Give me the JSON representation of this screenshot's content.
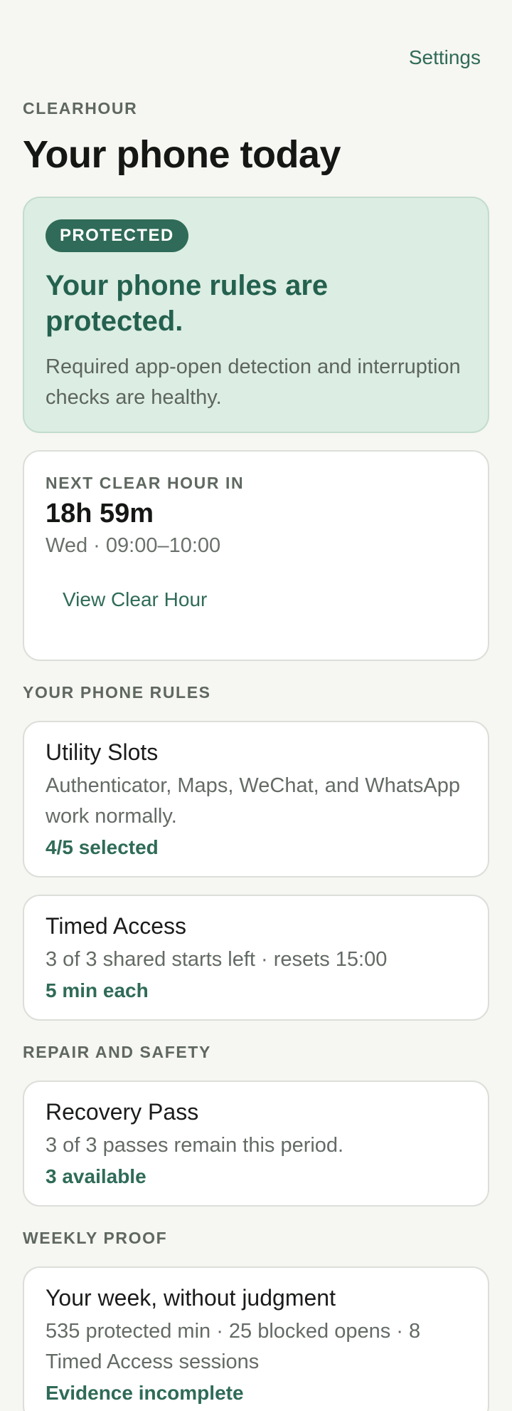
{
  "header": {
    "settings_label": "Settings",
    "app_name": "CLEARHOUR",
    "title": "Your phone today"
  },
  "status": {
    "badge": "PROTECTED",
    "heading": "Your phone rules are protected.",
    "body": "Required app-open detection and interruption checks are healthy.",
    "accent_color": "#2f6b58",
    "background_color": "#dcede3"
  },
  "next_clear_hour": {
    "label": "NEXT CLEAR HOUR IN",
    "countdown": "18h 59m",
    "schedule": "Wed · 09:00–10:00",
    "action_label": "View Clear Hour"
  },
  "sections": {
    "rules_label": "YOUR PHONE RULES",
    "repair_label": "REPAIR AND SAFETY",
    "weekly_label": "WEEKLY PROOF"
  },
  "utility_slots": {
    "title": "Utility Slots",
    "body": "Authenticator, Maps, WeChat, and WhatsApp work normally.",
    "meta": "4/5 selected"
  },
  "timed_access": {
    "title": "Timed Access",
    "body": "3 of 3 shared starts left · resets 15:00",
    "meta": "5 min each"
  },
  "recovery_pass": {
    "title": "Recovery Pass",
    "body": "3 of 3 passes remain this period.",
    "meta": "3 available"
  },
  "weekly_proof": {
    "title": "Your week, without judgment",
    "body": "535 protected min · 25 blocked opens · 8 Timed Access sessions",
    "meta": "Evidence incomplete"
  }
}
